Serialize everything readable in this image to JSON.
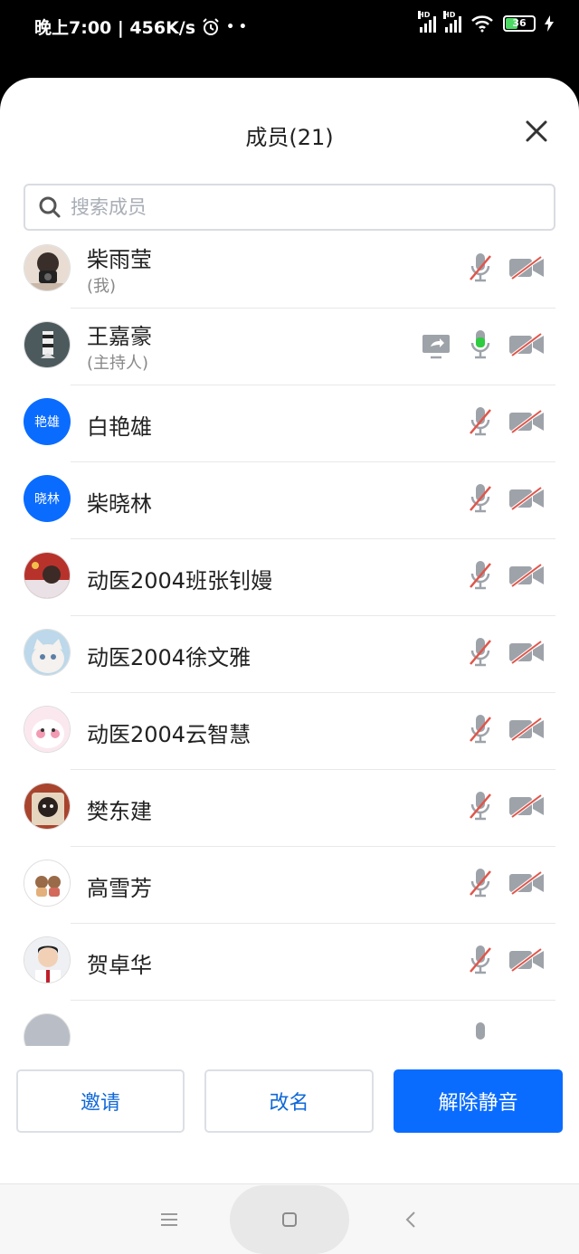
{
  "status": {
    "time_speed": "晚上7:00 | 456K/s",
    "hd": "HD",
    "battery": "36"
  },
  "header": {
    "title": "成员(21)"
  },
  "search": {
    "placeholder": "搜索成员"
  },
  "members": [
    {
      "name": "柴雨莹",
      "role": "(我)",
      "avatar": "photo"
    },
    {
      "name": "王嘉豪",
      "role": "(主持人)",
      "avatar": "photo",
      "sharing": true,
      "mic_on": true
    },
    {
      "name": "白艳雄",
      "avatar_text": "艳雄"
    },
    {
      "name": "柴晓林",
      "avatar_text": "晓林"
    },
    {
      "name": "动医2004班张钊嫚",
      "avatar": "photo"
    },
    {
      "name": "动医2004徐文雅",
      "avatar": "photo"
    },
    {
      "name": "动医2004云智慧",
      "avatar": "photo"
    },
    {
      "name": "樊东建",
      "avatar": "photo"
    },
    {
      "name": "高雪芳",
      "avatar": "photo"
    },
    {
      "name": "贺卓华",
      "avatar": "photo"
    }
  ],
  "buttons": {
    "invite": "邀请",
    "rename": "改名",
    "unmute": "解除静音"
  },
  "colors": {
    "accent": "#0a6cff",
    "mic_active": "#2ecc40",
    "muted_slash": "#e0554a"
  }
}
